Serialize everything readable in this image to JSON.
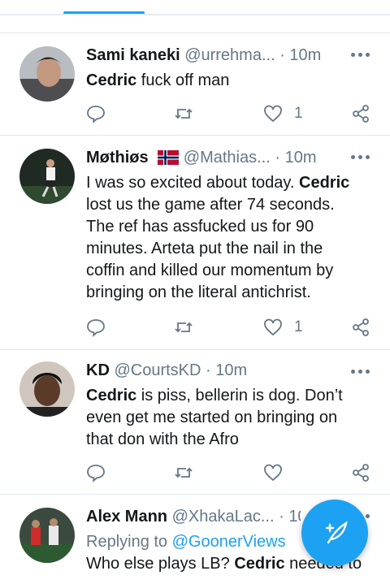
{
  "tweets": [
    {
      "name": "Sami kaneki",
      "handle": "@urrehma...",
      "sep": " · ",
      "time": "10m",
      "segments": [
        {
          "bold": "Cedric",
          "text": " fuck off man"
        }
      ],
      "likes": "1"
    },
    {
      "name": "Møthiøs",
      "handle": "@Mathias...",
      "sep": " · ",
      "time": "10m",
      "lines": [
        "I was so excited about today. ",
        "lost us the game after 74 seconds.",
        "The ref has assfucked us for 90",
        "minutes. Arteta put the nail in the",
        "coffin and killed our momentum by",
        "bringing on the literal antichrist."
      ],
      "bold": "Cedric",
      "likes": "1"
    },
    {
      "name": "KD",
      "handle": "@CourtsKD",
      "sep": " · ",
      "time": "10m",
      "lines": [
        " is piss, bellerin is dog. Don’t",
        "even get me started on bringing on",
        "that don with the Afro"
      ],
      "bold": "Cedric"
    },
    {
      "name": "Alex Mann",
      "handle": "@XhakaLac...",
      "sep": " · ",
      "time": "10m",
      "replying_label": "Replying to ",
      "replying_to": "@GoonerViews",
      "lines": [
        "Who else plays LB? ",
        " needed to"
      ],
      "bold": "Cedric"
    }
  ],
  "icons": {
    "reply": "reply-icon",
    "retweet": "retweet-icon",
    "like": "heart-icon",
    "share": "share-icon",
    "more": "more-icon",
    "compose": "compose-icon"
  },
  "colors": {
    "accent": "#1da1f2",
    "secondary": "#657786",
    "divider": "#e1e8ed"
  }
}
